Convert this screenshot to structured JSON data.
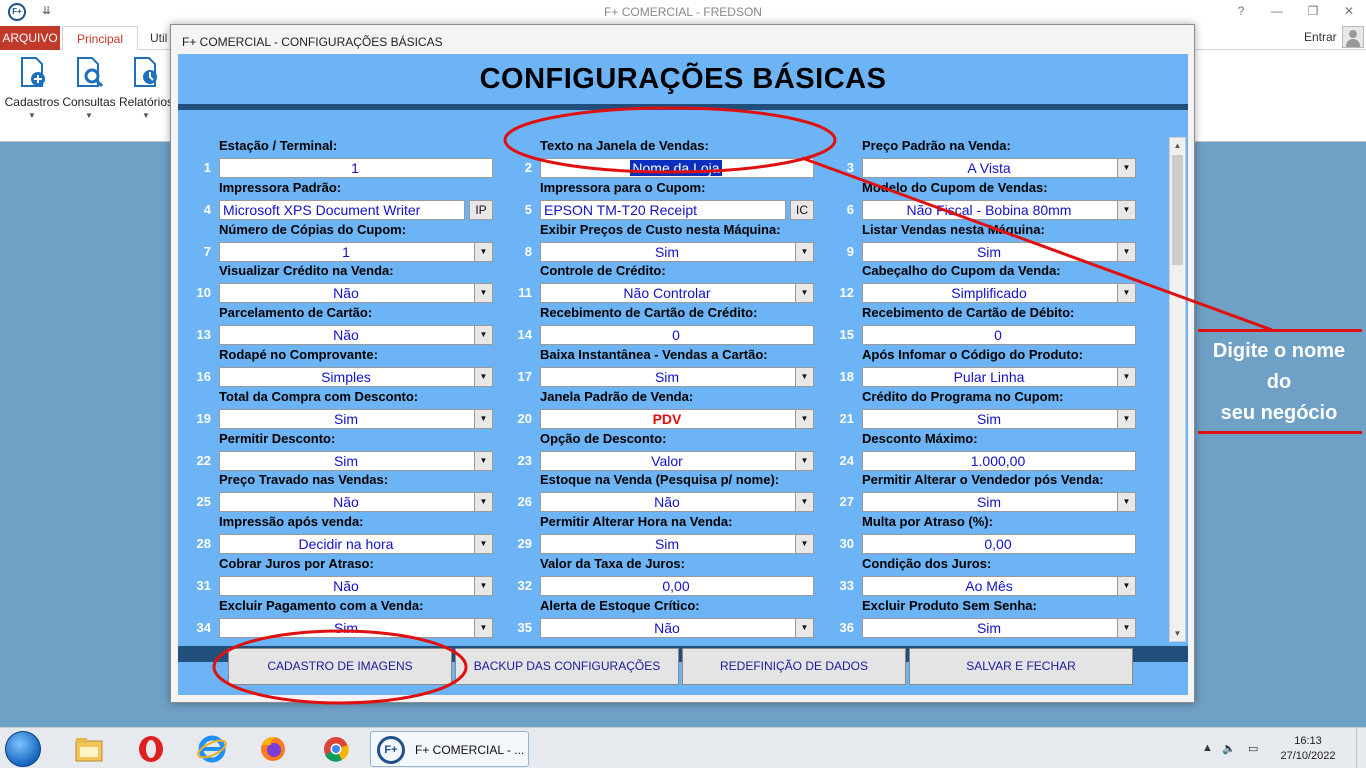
{
  "app": {
    "title": "F+ COMERCIAL - FREDSON",
    "logo_text": "F+",
    "qat_symbol": "⇊",
    "tabs": [
      "ARQUIVO",
      "Principal",
      "Util"
    ],
    "signin": "Entrar",
    "ribbon": [
      {
        "label": "Cadastros",
        "icon": "cadastros-icon"
      },
      {
        "label": "Consultas",
        "icon": "consultas-icon"
      },
      {
        "label": "Relatórios",
        "icon": "relatorios-icon"
      }
    ],
    "window_buttons": [
      "?",
      "—",
      "❐",
      "✕"
    ]
  },
  "dialog": {
    "window_title": "F+ COMERCIAL - CONFIGURAÇÕES BÁSICAS",
    "heading": "CONFIGURAÇÕES BÁSICAS",
    "fields": [
      {
        "n": "1",
        "label": "Estação / Terminal:",
        "value": "1",
        "type": "text"
      },
      {
        "n": "2",
        "label": "Texto na Janela de Vendas:",
        "value": "Nome da Loja",
        "type": "text",
        "selected": true
      },
      {
        "n": "3",
        "label": "Preço Padrão na Venda:",
        "value": "A Vista",
        "type": "select"
      },
      {
        "n": "4",
        "label": "Impressora Padrão:",
        "value": "Microsoft XPS Document Writer",
        "type": "text-btn",
        "btn": "IP"
      },
      {
        "n": "5",
        "label": "Impressora para o Cupom:",
        "value": "EPSON TM-T20 Receipt",
        "type": "text-btn",
        "btn": "IC"
      },
      {
        "n": "6",
        "label": "Modelo do Cupom de Vendas:",
        "value": "Não Fiscal - Bobina 80mm",
        "type": "select"
      },
      {
        "n": "7",
        "label": "Número de Cópias do Cupom:",
        "value": "1",
        "type": "select"
      },
      {
        "n": "8",
        "label": "Exibir Preços de Custo nesta Máquina:",
        "value": "Sim",
        "type": "select"
      },
      {
        "n": "9",
        "label": "Listar Vendas nesta Máquina:",
        "value": "Sim",
        "type": "select"
      },
      {
        "n": "10",
        "label": "Visualizar Crédito na Venda:",
        "value": "Não",
        "type": "select"
      },
      {
        "n": "11",
        "label": "Controle de Crédito:",
        "value": "Não Controlar",
        "type": "select"
      },
      {
        "n": "12",
        "label": "Cabeçalho do Cupom da Venda:",
        "value": "Simplificado",
        "type": "select"
      },
      {
        "n": "13",
        "label": "Parcelamento de Cartão:",
        "value": "Não",
        "type": "select"
      },
      {
        "n": "14",
        "label": "Recebimento de Cartão de Crédito:",
        "value": "0",
        "type": "text"
      },
      {
        "n": "15",
        "label": "Recebimento de Cartão de Débito:",
        "value": "0",
        "type": "text"
      },
      {
        "n": "16",
        "label": "Rodapé no Comprovante:",
        "value": "Simples",
        "type": "select"
      },
      {
        "n": "17",
        "label": "Baixa Instantânea - Vendas a Cartão:",
        "value": "Sim",
        "type": "select"
      },
      {
        "n": "18",
        "label": "Após Infomar o Código do Produto:",
        "value": "Pular Linha",
        "type": "select"
      },
      {
        "n": "19",
        "label": "Total da Compra com Desconto:",
        "value": "Sim",
        "type": "select"
      },
      {
        "n": "20",
        "label": "Janela Padrão de Venda:",
        "value": "PDV",
        "type": "select",
        "red": true
      },
      {
        "n": "21",
        "label": "Crédito do Programa no Cupom:",
        "value": "Sim",
        "type": "select"
      },
      {
        "n": "22",
        "label": "Permitir Desconto:",
        "value": "Sim",
        "type": "select"
      },
      {
        "n": "23",
        "label": "Opção de Desconto:",
        "value": "Valor",
        "type": "select"
      },
      {
        "n": "24",
        "label": "Desconto Máximo:",
        "value": "1.000,00",
        "type": "text"
      },
      {
        "n": "25",
        "label": "Preço Travado nas Vendas:",
        "value": "Não",
        "type": "select"
      },
      {
        "n": "26",
        "label": "Estoque na Venda (Pesquisa p/ nome):",
        "value": "Não",
        "type": "select"
      },
      {
        "n": "27",
        "label": "Permitir Alterar o Vendedor pós Venda:",
        "value": "Sim",
        "type": "select"
      },
      {
        "n": "28",
        "label": "Impressão após venda:",
        "value": "Decidir na hora",
        "type": "select"
      },
      {
        "n": "29",
        "label": "Permitir Alterar Hora na Venda:",
        "value": "Sim",
        "type": "select"
      },
      {
        "n": "30",
        "label": "Multa por Atraso (%):",
        "value": "0,00",
        "type": "text"
      },
      {
        "n": "31",
        "label": "Cobrar Juros por Atraso:",
        "value": "Não",
        "type": "select"
      },
      {
        "n": "32",
        "label": "Valor da Taxa de Juros:",
        "value": "0,00",
        "type": "text"
      },
      {
        "n": "33",
        "label": "Condição dos Juros:",
        "value": "Ao Mês",
        "type": "select"
      },
      {
        "n": "34",
        "label": "Excluir Pagamento com a Venda:",
        "value": "Sim",
        "type": "select"
      },
      {
        "n": "35",
        "label": "Alerta de Estoque Crítico:",
        "value": "Não",
        "type": "select"
      },
      {
        "n": "36",
        "label": "Excluir Produto Sem Senha:",
        "value": "Sim",
        "type": "select"
      }
    ],
    "buttons": [
      {
        "label": "CADASTRO DE IMAGENS",
        "name": "cadastro-imagens-button"
      },
      {
        "label": "BACKUP DAS CONFIGURAÇÕES",
        "name": "backup-configuracoes-button"
      },
      {
        "label": "REDEFINIÇÃO DE DADOS",
        "name": "redefinicao-dados-button"
      },
      {
        "label": "SALVAR E FECHAR",
        "name": "salvar-fechar-button"
      }
    ]
  },
  "annotation": {
    "line1": "Digite o nome",
    "line2": "do",
    "line3": "seu negócio",
    "color": "#e01010"
  },
  "taskbar": {
    "task_label": "F+ COMERCIAL - ...",
    "task_logo": "F+",
    "clock_time": "16:13",
    "clock_date": "27/10/2022",
    "tray_arrow": "▲",
    "tray_speaker": "🔈",
    "tray_network": "▭"
  }
}
